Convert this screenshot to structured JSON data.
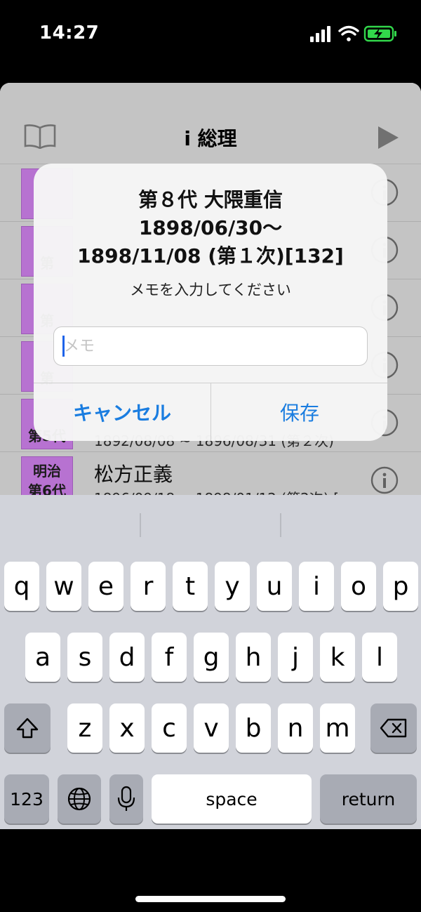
{
  "status_bar": {
    "time": "14:27",
    "icons": [
      "signal-icon",
      "wifi-icon",
      "battery-charging-icon"
    ],
    "battery_color": "#32d74b"
  },
  "nav": {
    "title": "i 総理",
    "left_icon": "book-icon",
    "right_icon": "play-icon"
  },
  "list": {
    "rows": [
      {
        "badge": "",
        "name": "",
        "dates": ""
      },
      {
        "badge": "第",
        "name": "",
        "dates": ""
      },
      {
        "badge": "第",
        "name": "",
        "dates": ""
      },
      {
        "badge": "第",
        "name": "",
        "dates": ""
      },
      {
        "badge": "第5代",
        "name": "",
        "dates": "1892/08/08 ~ 1896/08/31 (第２次)"
      },
      {
        "badge": "明治\n第6代",
        "name": "松方正義",
        "dates": "1896/09/18 ~ 1898/01/12 (第2次) ["
      }
    ],
    "badge_color": "#e08cff"
  },
  "alert": {
    "title_line1": "第８代 大隈重信",
    "title_line2": "1898/06/30～",
    "title_line3": "1898/11/08 (第１次)[132]",
    "message": "メモを入力してください",
    "input_placeholder": "メモ",
    "input_value": "",
    "cancel_label": "キャンセル",
    "save_label": "保存",
    "accent_color": "#1a7de0"
  },
  "keyboard": {
    "row1": [
      "q",
      "w",
      "e",
      "r",
      "t",
      "y",
      "u",
      "i",
      "o",
      "p"
    ],
    "row2": [
      "a",
      "s",
      "d",
      "f",
      "g",
      "h",
      "j",
      "k",
      "l"
    ],
    "row3": [
      "z",
      "x",
      "c",
      "v",
      "b",
      "n",
      "m"
    ],
    "numbers_label": "123",
    "space_label": "space",
    "return_label": "return"
  }
}
